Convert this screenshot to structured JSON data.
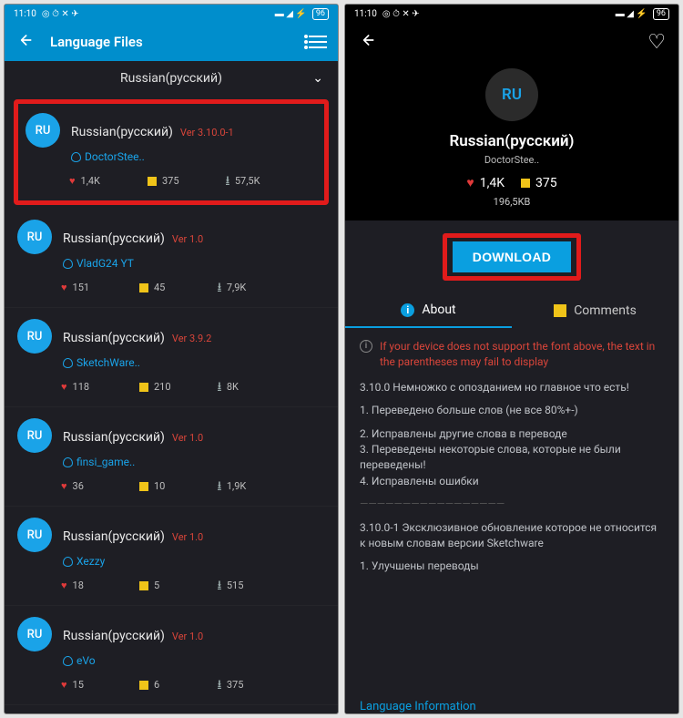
{
  "statusbar": {
    "time": "11:10",
    "icons": "◎ ⏱ ✕ ✈",
    "signal": "▬ ◢ ⚡",
    "battery": "96"
  },
  "left": {
    "title": "Language Files",
    "subheader": "Russian(русский)",
    "items": [
      {
        "avatar": "RU",
        "name": "Russian(русский)",
        "ver": "Ver 3.10.0-1",
        "author": "DoctorStee..",
        "likes": "1,4K",
        "comments": "375",
        "downloads": "57,5K",
        "highlight": true
      },
      {
        "avatar": "RU",
        "name": "Russian(русский)",
        "ver": "Ver 1.0",
        "author": "VladG24 YT",
        "likes": "151",
        "comments": "45",
        "downloads": "7,9K"
      },
      {
        "avatar": "RU",
        "name": "Russian(русский)",
        "ver": "Ver 3.9.2",
        "author": "SketchWare..",
        "likes": "118",
        "comments": "210",
        "downloads": "8K"
      },
      {
        "avatar": "RU",
        "name": "Russian(русский)",
        "ver": "Ver 1.0",
        "author": "finsi_game..",
        "likes": "36",
        "comments": "10",
        "downloads": "1,9K"
      },
      {
        "avatar": "RU",
        "name": "Russian(русский)",
        "ver": "Ver 1.0",
        "author": "Xezzy",
        "likes": "18",
        "comments": "5",
        "downloads": "515"
      },
      {
        "avatar": "RU",
        "name": "Russian(русский)",
        "ver": "Ver 1.0",
        "author": "eVo",
        "likes": "15",
        "comments": "6",
        "downloads": "375"
      }
    ]
  },
  "right": {
    "avatar": "RU",
    "name": "Russian(русский)",
    "author": "DoctorStee..",
    "likes": "1,4K",
    "comments": "375",
    "size": "196,5KB",
    "download": "DOWNLOAD",
    "tabs": {
      "about": "About",
      "comments": "Comments"
    },
    "warning": "If your device does not support the font above, the text in the parentheses may fail to display",
    "body": {
      "p1": "3.10.0 Немножко с опозданием но главное что есть!",
      "l1": "1. Переведено больше слов (не все 80%+-)",
      "l2": "2. Исправлены другие слова в переводе",
      "l3": "3. Переведены некоторые слова, которые не были переведены!",
      "l4": "4. Исправлены ошибки",
      "sep": "—————————————————",
      "p2": "3.10.0-1 Эксклюзивное обновление которое не относится к новым словам версии Sketchware",
      "l5": "1. Улучшены переводы"
    },
    "bottom": "Language Information"
  }
}
